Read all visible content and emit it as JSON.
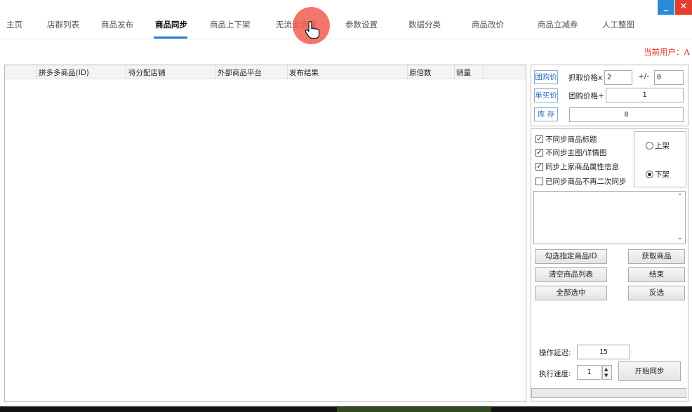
{
  "window": {
    "minimize_label": "_",
    "close_label": "✕"
  },
  "nav": {
    "items": [
      "主页",
      "店群列表",
      "商品发布",
      "商品同步",
      "商品上下架",
      "无流量清理",
      "参数设置",
      "数据分类",
      "商品改价",
      "商品立减券",
      "人工整图"
    ],
    "active_index": 3,
    "accent_color": "#2b7fd6"
  },
  "current_user": "当前用户：A",
  "table": {
    "columns": [
      "拼多多商品(ID)",
      "待分配店铺",
      "外部商品平台",
      "发布结果",
      "原倍数",
      "销量"
    ],
    "rows": []
  },
  "pricing": {
    "group_buy_tag": "团购价",
    "single_buy_tag": "单买价",
    "stock_tag": "库 存",
    "fetch_price_label": "抓取价格x",
    "fetch_price_value": "2",
    "plus_minus_label": "+/-",
    "plus_minus_value": "0",
    "group_price_label": "团购价格+",
    "group_price_value": "1",
    "stock_value": "0"
  },
  "options": {
    "no_sync_title": {
      "label": "不同步商品标题",
      "checked": true
    },
    "no_sync_images": {
      "label": "不同步主图/详情图",
      "checked": true
    },
    "sync_attributes": {
      "label": "同步上家商品属性信息",
      "checked": true
    },
    "no_resync": {
      "label": "已同步商品不再二次同步",
      "checked": false
    },
    "radio_on_shelf": {
      "label": "上架",
      "selected": false
    },
    "radio_off_shelf": {
      "label": "下架",
      "selected": true
    }
  },
  "buttons": {
    "select_ids": "勾选指定商品ID",
    "get_products": "获取商品",
    "clear_list": "清空商品列表",
    "end": "结束",
    "select_all": "全部选中",
    "invert": "反选",
    "start_sync": "开始同步"
  },
  "settings": {
    "delay_label": "操作延迟:",
    "delay_value": "15",
    "speed_label": "执行速度:",
    "speed_value": "1"
  },
  "colors": {
    "warning_red": "#e0281c",
    "close_red": "#e33d2c",
    "minimize_blue": "#2b8ad8"
  },
  "icons": {
    "cursor": "hand-pointer-icon"
  }
}
